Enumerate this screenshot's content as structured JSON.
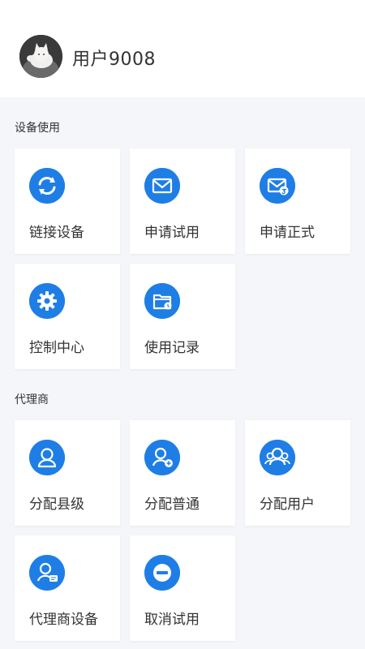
{
  "user": {
    "name": "用户9008",
    "avatar": "cat-avatar"
  },
  "sections": [
    {
      "title": "设备使用",
      "items": [
        {
          "label": "链接设备",
          "icon": "sync-icon"
        },
        {
          "label": "申请试用",
          "icon": "mail-icon"
        },
        {
          "label": "申请正式",
          "icon": "mail-badge-icon"
        },
        {
          "label": "控制中心",
          "icon": "gear-icon"
        },
        {
          "label": "使用记录",
          "icon": "folder-icon"
        }
      ]
    },
    {
      "title": "代理商",
      "items": [
        {
          "label": "分配县级",
          "icon": "user-icon"
        },
        {
          "label": "分配普通",
          "icon": "user-add-icon"
        },
        {
          "label": "分配用户",
          "icon": "users-icon"
        },
        {
          "label": "代理商设备",
          "icon": "user-device-icon"
        },
        {
          "label": "取消试用",
          "icon": "minus-circle-icon"
        }
      ]
    }
  ],
  "colors": {
    "accent": "#1e7ee6",
    "background": "#f5f6fa",
    "card": "#ffffff"
  }
}
